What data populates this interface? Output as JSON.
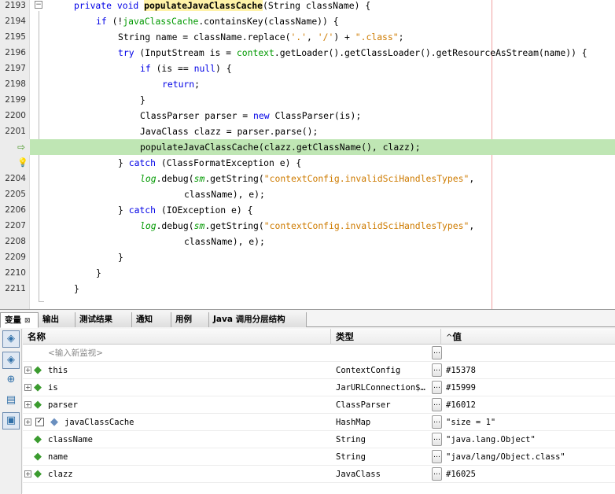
{
  "editor": {
    "lines": [
      {
        "num": "2193",
        "html": "<span class=\"kw\">private void</span> <span class=\"mbold\">populateJavaClassCache</span>(String className) {",
        "indent": 2
      },
      {
        "num": "2194",
        "html": "<span class=\"kw\">if</span> (!<span class=\"fld\">javaClassCache</span>.containsKey(className)) {",
        "indent": 4
      },
      {
        "num": "2195",
        "html": "String name = className.replace(<span class=\"str\">'.'</span>, <span class=\"str\">'/'</span>) + <span class=\"str\">\".class\"</span>;",
        "indent": 6
      },
      {
        "num": "2196",
        "html": "<span class=\"kw\">try</span> (InputStream is = <span class=\"fld\">context</span>.getLoader().getClassLoader().getResourceAsStream(name)) {",
        "indent": 6
      },
      {
        "num": "2197",
        "html": "<span class=\"kw\">if</span> (is == <span class=\"kw\">null</span>) {",
        "indent": 8
      },
      {
        "num": "2198",
        "html": "<span class=\"kw\">return</span>;",
        "indent": 10
      },
      {
        "num": "2199",
        "html": "}",
        "indent": 8
      },
      {
        "num": "2200",
        "html": "ClassParser parser = <span class=\"kw\">new</span> ClassParser(is);",
        "indent": 8
      },
      {
        "num": "2201",
        "html": "JavaClass clazz = parser.parse();",
        "indent": 8
      },
      {
        "num": "",
        "html": "populateJavaClassCache(clazz.getClassName(), clazz);",
        "indent": 8,
        "glyph": "arrow",
        "highlight": true
      },
      {
        "num": "",
        "html": "} <span class=\"kw\">catch</span> (ClassFormatException e) {",
        "indent": 6,
        "glyph": "bulb"
      },
      {
        "num": "2204",
        "html": "<span class=\"fld-i\">log</span>.debug(<span class=\"fld-i\">sm</span>.getString(<span class=\"str\">\"contextConfig.invalidSciHandlesTypes\"</span>,",
        "indent": 8
      },
      {
        "num": "2205",
        "html": "className), e);",
        "indent": 12
      },
      {
        "num": "2206",
        "html": "} <span class=\"kw\">catch</span> (IOException e) {",
        "indent": 6
      },
      {
        "num": "2207",
        "html": "<span class=\"fld-i\">log</span>.debug(<span class=\"fld-i\">sm</span>.getString(<span class=\"str\">\"contextConfig.invalidSciHandlesTypes\"</span>,",
        "indent": 8
      },
      {
        "num": "2208",
        "html": "className), e);",
        "indent": 12
      },
      {
        "num": "2209",
        "html": "}",
        "indent": 6
      },
      {
        "num": "2210",
        "html": "}",
        "indent": 4
      },
      {
        "num": "2211",
        "html": "}",
        "indent": 2
      }
    ]
  },
  "panel": {
    "tabs": [
      {
        "label": "变量",
        "active": true,
        "closable": true
      },
      {
        "label": "输出"
      },
      {
        "label": "测试结果"
      },
      {
        "label": "通知"
      },
      {
        "label": "用例"
      },
      {
        "label": "Java 调用分层结构"
      }
    ],
    "columns": {
      "name": "名称",
      "type": "类型",
      "value": "值",
      "sort_indicator": "^"
    },
    "watch_placeholder": "<输入新监视>",
    "rows": [
      {
        "name": "this",
        "type": "ContextConfig",
        "value": "#15378",
        "expandable": true,
        "icon": "static"
      },
      {
        "name": "is",
        "type": "JarURLConnection$…",
        "value": "#15999",
        "expandable": true
      },
      {
        "name": "parser",
        "type": "ClassParser",
        "value": "#16012",
        "expandable": true
      },
      {
        "name": "javaClassCache",
        "type": "HashMap",
        "value": "\"size = 1\"",
        "expandable": true,
        "checkbox": true,
        "icon": "field"
      },
      {
        "name": "className",
        "type": "String",
        "value": "\"java.lang.Object\""
      },
      {
        "name": "name",
        "type": "String",
        "value": "\"java/lang/Object.class\""
      },
      {
        "name": "clazz",
        "type": "JavaClass",
        "value": "#16025",
        "expandable": true
      }
    ],
    "ellipsis_label": "…",
    "toolbar_icons": [
      "watch-icon",
      "watch-add-icon",
      "new-watch-icon",
      "breakpoint-icon",
      "layout-icon"
    ]
  }
}
